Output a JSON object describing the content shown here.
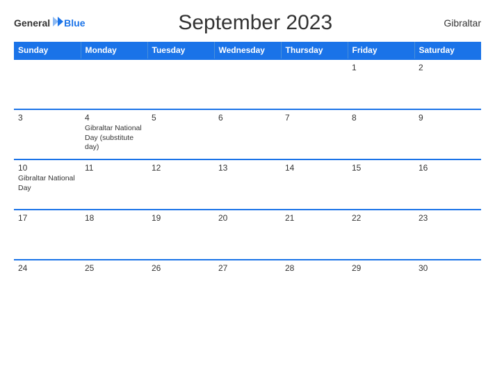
{
  "header": {
    "logo": {
      "general": "General",
      "blue": "Blue",
      "flag_symbol": "▶"
    },
    "title": "September 2023",
    "region": "Gibraltar"
  },
  "days_of_week": [
    "Sunday",
    "Monday",
    "Tuesday",
    "Wednesday",
    "Thursday",
    "Friday",
    "Saturday"
  ],
  "weeks": [
    {
      "days": [
        {
          "num": "",
          "events": []
        },
        {
          "num": "",
          "events": []
        },
        {
          "num": "",
          "events": []
        },
        {
          "num": "",
          "events": []
        },
        {
          "num": "",
          "events": []
        },
        {
          "num": "1",
          "events": []
        },
        {
          "num": "2",
          "events": []
        }
      ]
    },
    {
      "days": [
        {
          "num": "3",
          "events": []
        },
        {
          "num": "4",
          "events": [
            "Gibraltar National Day (substitute day)"
          ]
        },
        {
          "num": "5",
          "events": []
        },
        {
          "num": "6",
          "events": []
        },
        {
          "num": "7",
          "events": []
        },
        {
          "num": "8",
          "events": []
        },
        {
          "num": "9",
          "events": []
        }
      ]
    },
    {
      "days": [
        {
          "num": "10",
          "events": [
            "Gibraltar National Day"
          ]
        },
        {
          "num": "11",
          "events": []
        },
        {
          "num": "12",
          "events": []
        },
        {
          "num": "13",
          "events": []
        },
        {
          "num": "14",
          "events": []
        },
        {
          "num": "15",
          "events": []
        },
        {
          "num": "16",
          "events": []
        }
      ]
    },
    {
      "days": [
        {
          "num": "17",
          "events": []
        },
        {
          "num": "18",
          "events": []
        },
        {
          "num": "19",
          "events": []
        },
        {
          "num": "20",
          "events": []
        },
        {
          "num": "21",
          "events": []
        },
        {
          "num": "22",
          "events": []
        },
        {
          "num": "23",
          "events": []
        }
      ]
    },
    {
      "days": [
        {
          "num": "24",
          "events": []
        },
        {
          "num": "25",
          "events": []
        },
        {
          "num": "26",
          "events": []
        },
        {
          "num": "27",
          "events": []
        },
        {
          "num": "28",
          "events": []
        },
        {
          "num": "29",
          "events": []
        },
        {
          "num": "30",
          "events": []
        }
      ]
    }
  ],
  "colors": {
    "header_bg": "#1a73e8",
    "border": "#1a73e8"
  }
}
